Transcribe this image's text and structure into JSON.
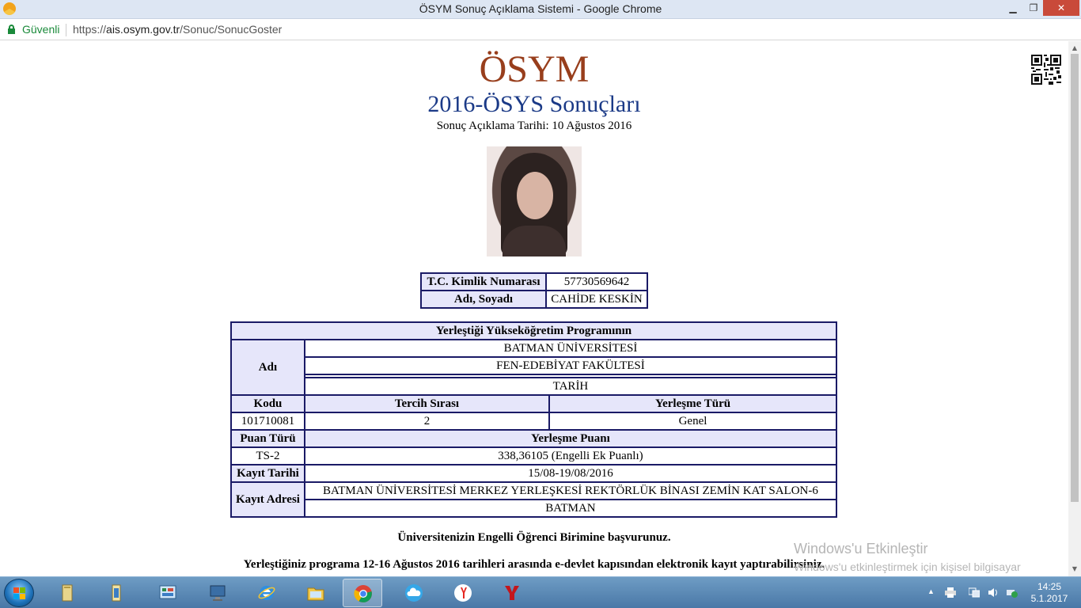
{
  "window": {
    "title": "ÖSYM Sonuç Açıklama Sistemi - Google Chrome",
    "minimize": "▁",
    "maximize": "❐",
    "close": "✕"
  },
  "address_bar": {
    "secure_label": "Güvenli",
    "url_scheme": "https://",
    "url_domain": "ais.osym.gov.tr",
    "url_path": "/Sonuc/SonucGoster"
  },
  "header": {
    "logo": "ÖSYM",
    "exam_title": "2016-ÖSYS Sonuçları",
    "announcement": "Sonuç Açıklama Tarihi: 10 Ağustos 2016"
  },
  "identity": {
    "id_label": "T.C. Kimlik Numarası",
    "id_value": "57730569642",
    "name_label": "Adı, Soyadı",
    "name_value": "CAHİDE KESKİN"
  },
  "placement": {
    "section_title": "Yerleştiği Yükseköğretim Programının",
    "name_label": "Adı",
    "university": "BATMAN ÜNİVERSİTESİ",
    "faculty": "FEN-EDEBİYAT FAKÜLTESİ",
    "program": "TARİH",
    "code_label": "Kodu",
    "preference_label": "Tercih Sırası",
    "placement_type_label": "Yerleşme Türü",
    "code_value": "101710081",
    "preference_value": "2",
    "placement_type_value": "Genel",
    "score_type_label": "Puan Türü",
    "score_label": "Yerleşme Puanı",
    "score_type_value": "TS-2",
    "score_value": "338,36105 (Engelli Ek Puanlı)",
    "registration_date_label": "Kayıt Tarihi",
    "registration_date_value": "15/08-19/08/2016",
    "registration_address_label": "Kayıt Adresi",
    "registration_address_line1": "BATMAN ÜNİVERSİTESİ MERKEZ YERLEŞKESİ REKTÖRLÜK BİNASI ZEMİN KAT SALON-6",
    "registration_address_line2": "BATMAN"
  },
  "notes": {
    "disability_note": "Üniversitenizin Engelli Öğrenci Birimine başvurunuz.",
    "registration_note": "Yerleştiğiniz programa 12-16 Ağustos 2016 tarihleri arasında e-devlet kapısından elektronik kayıt yaptırabilirsiniz."
  },
  "watermark": {
    "title": "Windows'u Etkinleştir",
    "text": "Windows'u etkinleştirmek için kişisel bilgisayar ayarlarına gidin."
  },
  "taskbar": {
    "items": [
      "file-explorer-icon",
      "folder-icon",
      "control-panel-icon",
      "computer-icon",
      "internet-explorer-icon",
      "file-manager-icon",
      "chrome-icon",
      "cloud-icon",
      "yandex-icon",
      "osym-app-icon"
    ],
    "time": "14:25",
    "date": "5.1.2017"
  },
  "colors": {
    "logo": "#983e1c",
    "title": "#1b3a87",
    "table_border": "#1a1a66",
    "header_cell": "#e6e6fa",
    "secure": "#1a8a3a"
  }
}
